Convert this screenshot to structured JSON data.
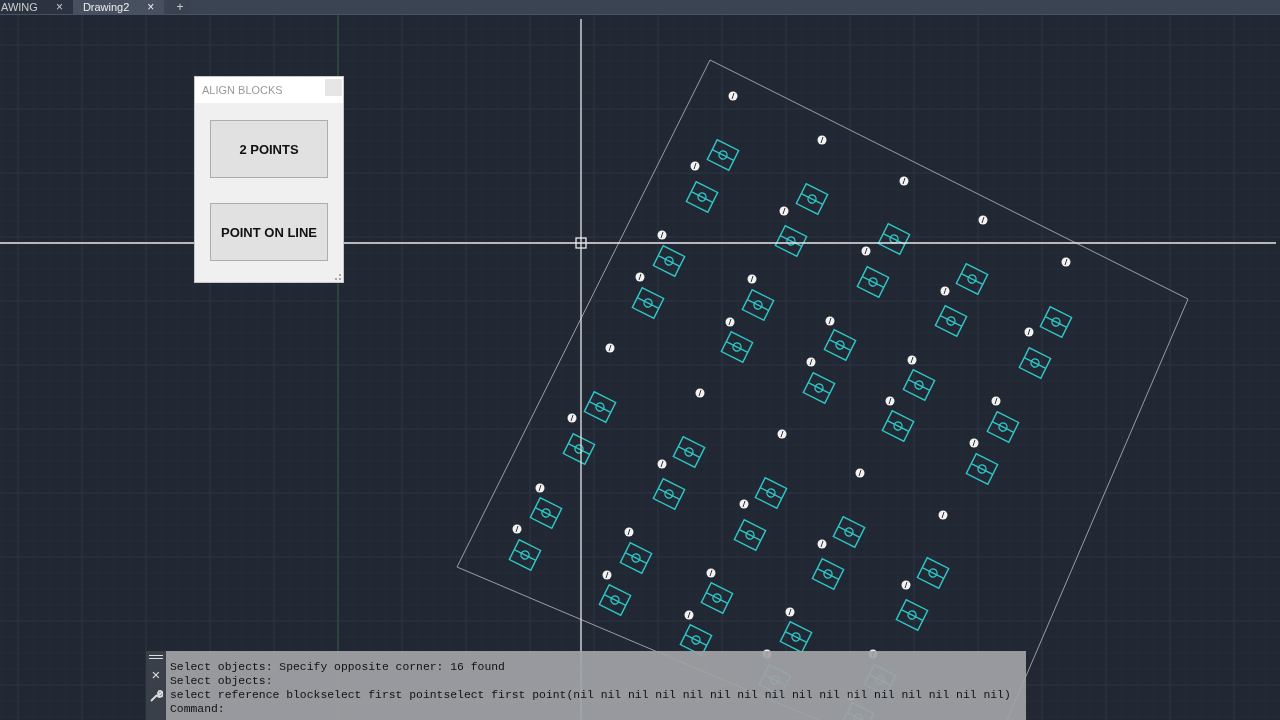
{
  "tabs": [
    {
      "label": "AWING",
      "close": "×",
      "selected": false
    },
    {
      "label": "Drawing2",
      "close": "×",
      "selected": true
    }
  ],
  "new_tab": "+",
  "dialog": {
    "title": "ALIGN BLOCKS",
    "buttons": [
      "2 POINTS",
      "POINT ON LINE"
    ]
  },
  "command_line": {
    "close": "×",
    "history": [
      "Select objects: Specify opposite corner: 16 found",
      "Select objects:",
      "select reference blockselect first pointselect first point(nil nil nil nil nil nil nil nil nil nil nil nil nil nil nil nil)"
    ],
    "prompt": "Command:"
  }
}
